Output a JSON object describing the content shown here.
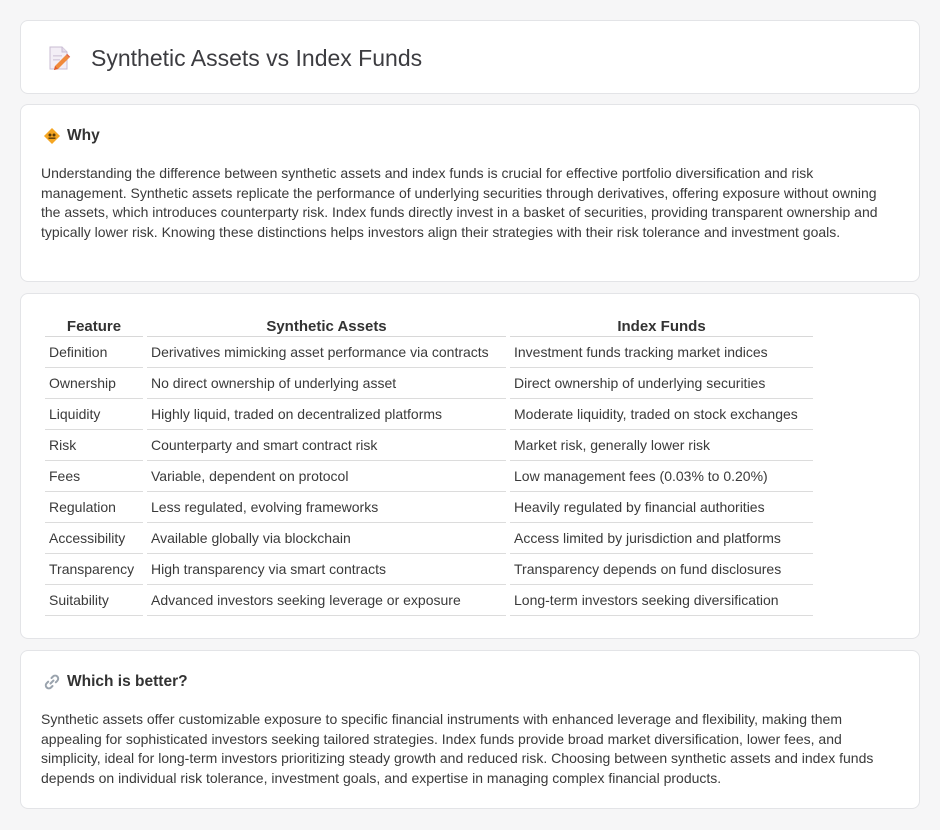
{
  "header": {
    "title": "Synthetic Assets vs Index Funds",
    "icon": "document-pencil-icon"
  },
  "why": {
    "icon": "diamond-warning-icon",
    "title": "Why",
    "text": "Understanding the difference between synthetic assets and index funds is crucial for effective portfolio diversification and risk management. Synthetic assets replicate the performance of underlying securities through derivatives, offering exposure without owning the assets, which introduces counterparty risk. Index funds directly invest in a basket of securities, providing transparent ownership and typically lower risk. Knowing these distinctions helps investors align their strategies with their risk tolerance and investment goals."
  },
  "comparison": {
    "headers": [
      "Feature",
      "Synthetic Assets",
      "Index Funds"
    ],
    "rows": [
      [
        "Definition",
        "Derivatives mimicking asset performance via contracts",
        "Investment funds tracking market indices"
      ],
      [
        "Ownership",
        "No direct ownership of underlying asset",
        "Direct ownership of underlying securities"
      ],
      [
        "Liquidity",
        "Highly liquid, traded on decentralized platforms",
        "Moderate liquidity, traded on stock exchanges"
      ],
      [
        "Risk",
        "Counterparty and smart contract risk",
        "Market risk, generally lower risk"
      ],
      [
        "Fees",
        "Variable, dependent on protocol",
        "Low management fees (0.03% to 0.20%)"
      ],
      [
        "Regulation",
        "Less regulated, evolving frameworks",
        "Heavily regulated by financial authorities"
      ],
      [
        "Accessibility",
        "Available globally via blockchain",
        "Access limited by jurisdiction and platforms"
      ],
      [
        "Transparency",
        "High transparency via smart contracts",
        "Transparency depends on fund disclosures"
      ],
      [
        "Suitability",
        "Advanced investors seeking leverage or exposure",
        "Long-term investors seeking diversification"
      ]
    ]
  },
  "better": {
    "icon": "link-icon",
    "title": "Which is better?",
    "text": "Synthetic assets offer customizable exposure to specific financial instruments with enhanced leverage and flexibility, making them appealing for sophisticated investors seeking tailored strategies. Index funds provide broad market diversification, lower fees, and simplicity, ideal for long-term investors prioritizing steady growth and reduced risk. Choosing between synthetic assets and index funds depends on individual risk tolerance, investment goals, and expertise in managing complex financial products."
  },
  "colors": {
    "background": "#f6f6f7",
    "card": "#ffffff",
    "border": "#e3e4e7",
    "accent_orange": "#f5a623"
  }
}
